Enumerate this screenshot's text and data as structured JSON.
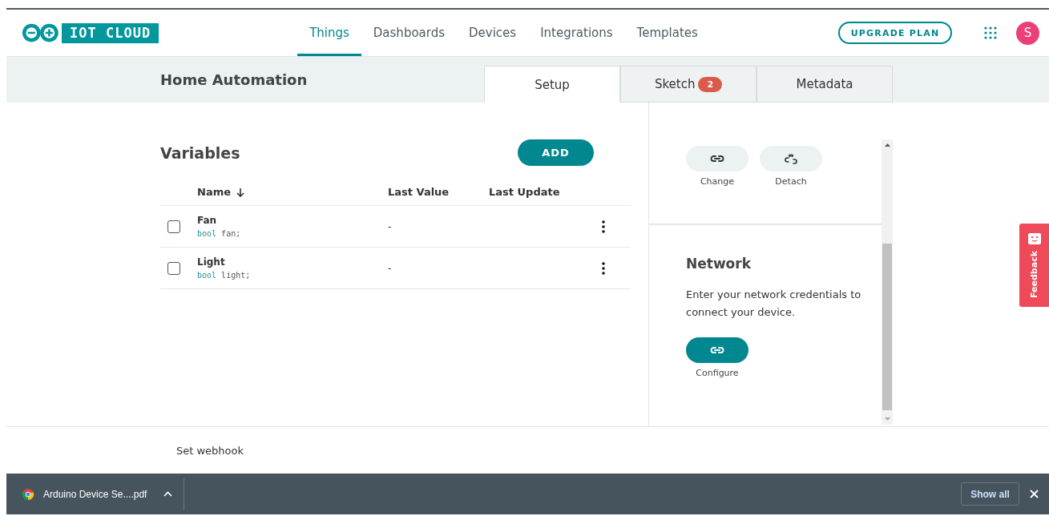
{
  "header": {
    "logo_text": "IOT CLOUD",
    "nav": [
      {
        "label": "Things",
        "selected": true
      },
      {
        "label": "Dashboards",
        "selected": false
      },
      {
        "label": "Devices",
        "selected": false
      },
      {
        "label": "Integrations",
        "selected": false
      },
      {
        "label": "Templates",
        "selected": false
      }
    ],
    "upgrade_button": "UPGRADE PLAN",
    "avatar": "S"
  },
  "thing": {
    "title": "Home Automation",
    "tabs": [
      {
        "label": "Setup",
        "selected": true
      },
      {
        "label": "Sketch",
        "selected": false,
        "badge": "2"
      },
      {
        "label": "Metadata",
        "selected": false
      }
    ]
  },
  "variables": {
    "title": "Variables",
    "add_button": "ADD",
    "columns": [
      "Name",
      "Last Value",
      "Last Update"
    ],
    "rows": [
      {
        "name": "Fan",
        "type": "bool",
        "declaration": "fan;",
        "last_value": "-",
        "checked": false
      },
      {
        "name": "Light",
        "type": "bool",
        "declaration": "light;",
        "last_value": "-",
        "checked": false
      }
    ]
  },
  "device_actions": [
    {
      "label": "Change",
      "kind": "link"
    },
    {
      "label": "Detach",
      "kind": "unlink"
    }
  ],
  "network": {
    "title": "Network",
    "description": "Enter your network credentials to connect your device.",
    "button": "Configure"
  },
  "feedback": "Feedback",
  "footer_link": "Set webhook",
  "download_bar": {
    "file": "Arduino Device Se....pdf",
    "show_all": "Show all"
  }
}
